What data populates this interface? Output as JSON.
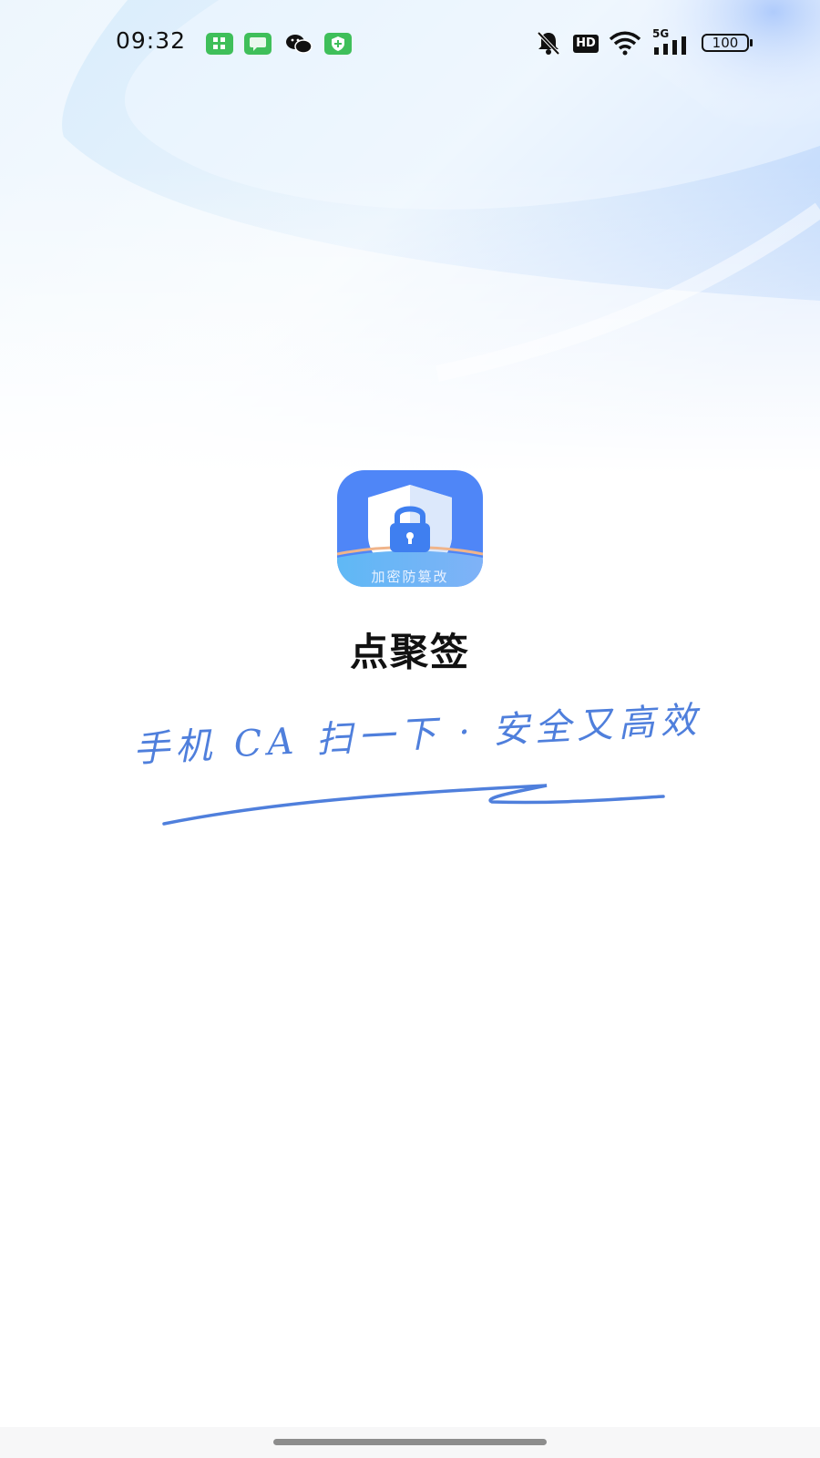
{
  "status_bar": {
    "time": "09:32",
    "notification_icons": [
      "app-grid-icon",
      "message-icon",
      "wechat-icon",
      "shield-plus-icon"
    ],
    "system_icons": [
      "silent-bell-icon",
      "hd-icon",
      "wifi-icon",
      "signal-5g-icon",
      "battery-icon"
    ],
    "hd_label": "HD",
    "network_label": "5G",
    "battery_level": "100"
  },
  "splash": {
    "app_icon_caption": "加密防篡改",
    "app_name": "点聚签",
    "slogan": "手机 CA 扫一下 · 安全又高效"
  },
  "colors": {
    "brand_blue": "#4f86f7",
    "slogan_blue": "#4f7fdc",
    "icon_green": "#3fbf5a"
  }
}
